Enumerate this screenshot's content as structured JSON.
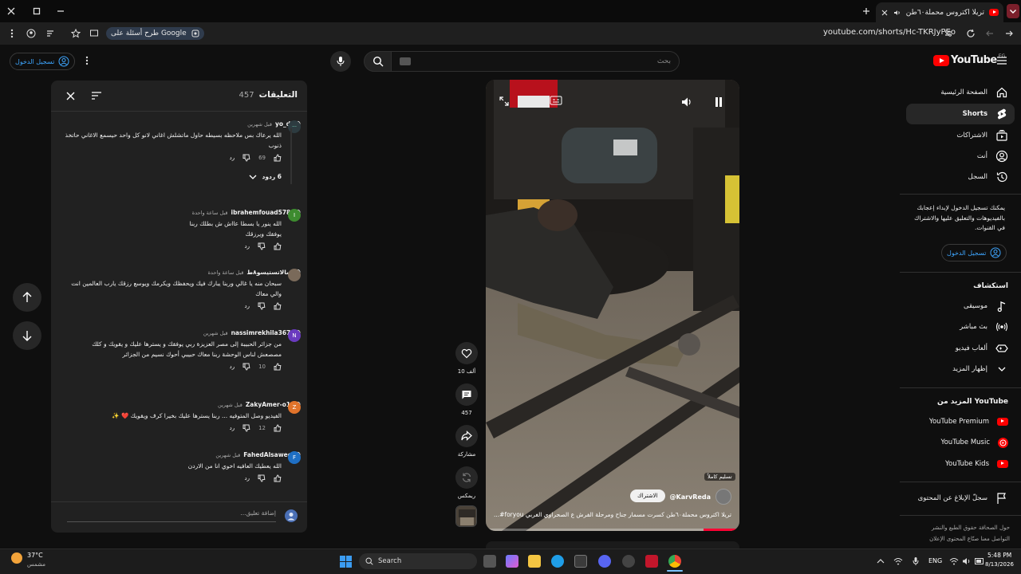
{
  "browser": {
    "tab_title": "تريلا اكتروس محملة٦٠طن ك",
    "url": "youtube.com/shorts/Hc-TKRJyPEo",
    "google_chip": "طرح أسئلة على Google"
  },
  "header": {
    "search_placeholder": "بحث",
    "signin_label": "تسجيل الدخول",
    "logo_text": "YouTube",
    "country": "EG"
  },
  "sidebar": {
    "items": [
      {
        "label": "الصفحة الرئيسية",
        "icon": "home-icon"
      },
      {
        "label": "Shorts",
        "icon": "shorts-icon"
      },
      {
        "label": "الاشتراكات",
        "icon": "subscriptions-icon"
      },
      {
        "label": "أنت",
        "icon": "you-icon"
      },
      {
        "label": "السجل",
        "icon": "history-icon"
      }
    ],
    "signin_prompt": "يمكنك تسجيل الدخول لإبداء إعجابك بالفيديوهات والتعليق عليها والاشتراك في القنوات.",
    "signin_button": "تسجيل الدخول",
    "explore_title": "استكشاف",
    "explore": [
      {
        "label": "موسيقى",
        "icon": "music-icon"
      },
      {
        "label": "بث مباشر",
        "icon": "live-icon"
      },
      {
        "label": "ألعاب فيديو",
        "icon": "gaming-icon"
      },
      {
        "label": "إظهار المزيد",
        "icon": "chevron-down-icon"
      }
    ],
    "more_title": "المزيد من YouTube",
    "more": [
      {
        "label": "YouTube Premium"
      },
      {
        "label": "YouTube Music"
      },
      {
        "label": "YouTube Kids"
      }
    ],
    "report": "سجلّ الإبلاغ عن المحتوى",
    "footer_line1": "حول  الصحافة  حقوق الطبع والنشر",
    "footer_line2": "التواصل معنا  صنّاع المحتوى  الإعلان"
  },
  "comments": {
    "title": "التعليقات",
    "count": "457",
    "add_placeholder": "إضافة تعليق...",
    "items": [
      {
        "user": "@yo_db",
        "time": "قبل شهرين",
        "text": "الله يرعاك بس ملاحظه بسيطه حاول ماتشلش اغاني لانو كل واحد حيسمع الاغاني حاتخذ ذنوب",
        "likes": "69",
        "reply": "رد",
        "replies": "6 ردود",
        "avatar_letter": "",
        "avatar_color": "#2d3b40"
      },
      {
        "user": "@ibrahemfouad5789",
        "time": "قبل ساعة واحدة",
        "text": "الله ينور يا بسطا عااش ش بطلك ربنا يوفقك ويرزقك",
        "likes": "",
        "reply": "رد",
        "avatar_letter": "I",
        "avatar_color": "#3d8b2f"
      },
      {
        "user": "@بسالاتستيسو٨ط",
        "time": "قبل ساعة واحدة",
        "text": "سبحان منه يا غالي وربنا يبارك فيك ويحفظك ويكرمك ويوسع رزقك يارب العالمين انت والي معاك",
        "likes": "",
        "reply": "رد",
        "avatar_letter": "",
        "avatar_color": "#7a6a5a"
      },
      {
        "user": "@nassimrekhila3674",
        "time": "قبل شهرين",
        "text": "من جزائر الحبيبة إلى مصر العزيزة ربي يوفقك و يسترها عليك و يقويك و كلك مصصعش لناس الوحشة ربنا معاك حبيبي أحوك نسيم من الجزائر",
        "likes": "10",
        "reply": "رد",
        "avatar_letter": "N",
        "avatar_color": "#6a3bbf"
      },
      {
        "user": "@ZakyAmer-o1g",
        "time": "قبل شهرين",
        "text": "الفيديو وصل المتوفيه ... ربنا يسترها عليك بخيرا كرف ويقويك ❤️ ✨",
        "likes": "12",
        "reply": "رد",
        "avatar_letter": "Z",
        "avatar_color": "#e0732b"
      },
      {
        "user": "@FahedAlsaweer",
        "time": "قبل شهرين",
        "text": "الله يعطيك العافيه اخوي انا من الاردن",
        "likes": "",
        "reply": "رد",
        "avatar_letter": "F",
        "avatar_color": "#1f6fc4"
      }
    ]
  },
  "video": {
    "channel": "@KarvReda",
    "subscribe": "الاشتراك",
    "caption": "تريلا اكتروس محملة٦٠طن كسرت مسمار جناح ومرحلة الفرش ع الصحراوي الغربي foryou#...",
    "badge": "تسليم كاملاً"
  },
  "actions": {
    "likes": "10 ألف",
    "comments": "457",
    "share": "مشاركة",
    "remix": "ريمكس"
  },
  "taskbar": {
    "search": "Search",
    "weather_temp": "37°C",
    "weather_desc": "مشمس",
    "lang": "ENG",
    "time": "5:48 PM",
    "date": "8/13/2026"
  }
}
